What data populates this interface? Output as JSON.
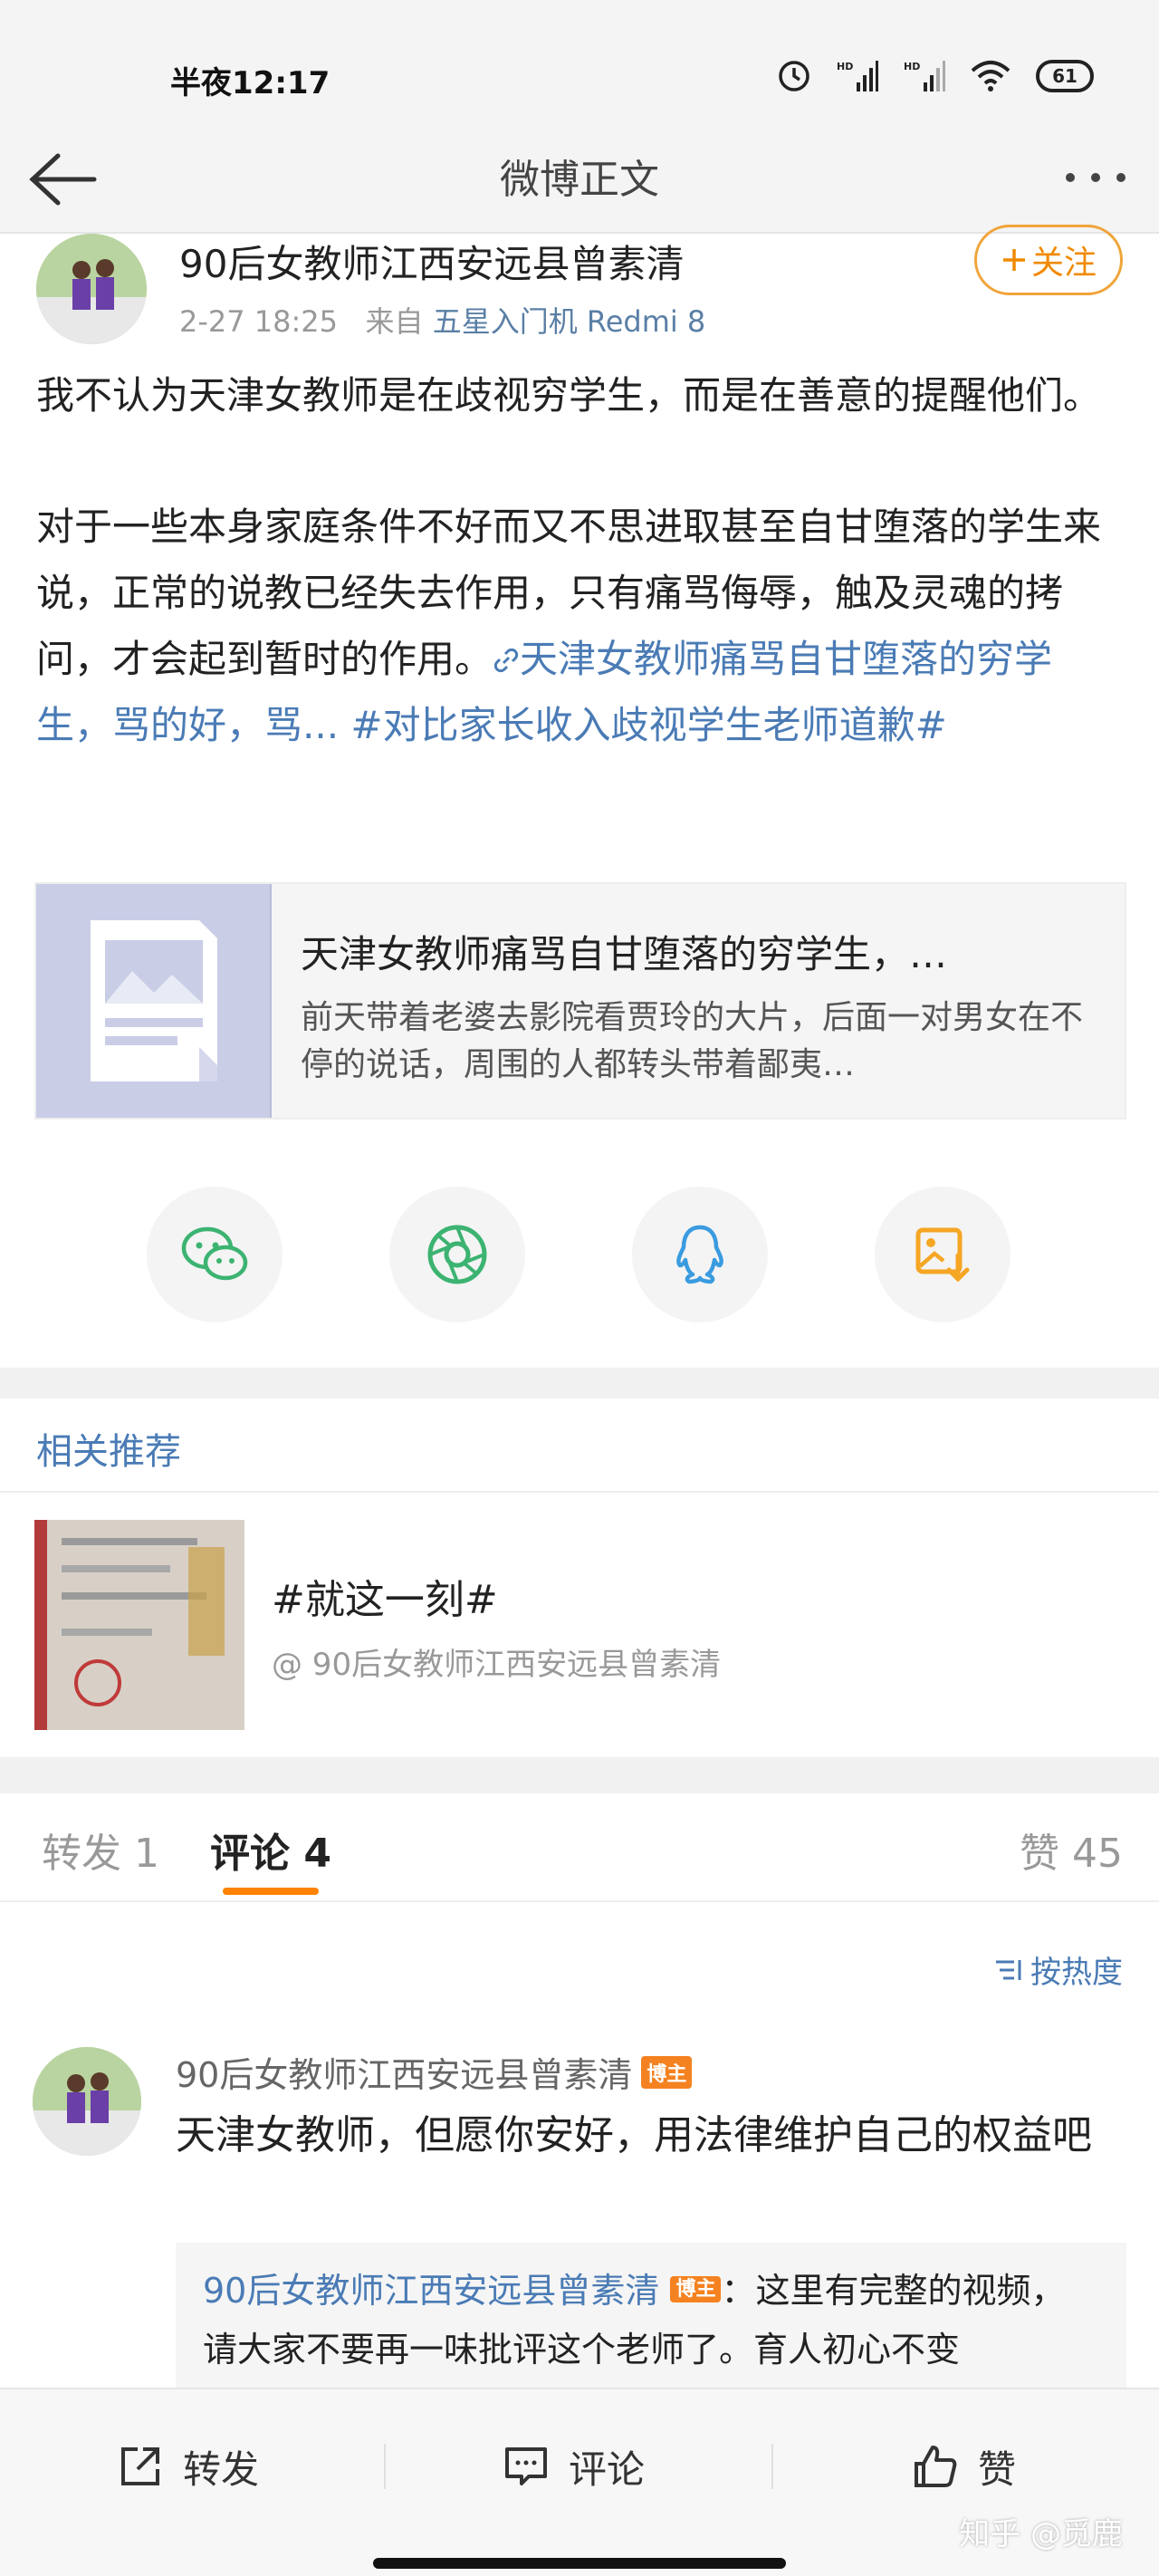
{
  "status_bar": {
    "time": "半夜12:17",
    "battery": "61",
    "icons": [
      "alarm-icon",
      "signal-hd-icon",
      "signal-hd-icon",
      "wifi-icon",
      "battery-icon"
    ]
  },
  "nav": {
    "title": "微博正文",
    "back_icon": "arrow-left-icon",
    "more_icon": "more-dots-icon"
  },
  "author": {
    "name": "90后女教师江西安远县曾素清",
    "time": "2-27 18:25",
    "from_label": "来自",
    "source": "五星入门机 Redmi 8",
    "follow_label": "关注"
  },
  "post": {
    "paragraph1": "我不认为天津女教师是在歧视穷学生，而是在善意的提醒他们。",
    "paragraph2_text": "对于一些本身家庭条件不好而又不思进取甚至自甘堕落的学生来说，正常的说教已经失去作用，只有痛骂侮辱，触及灵魂的拷问，才会起到暂时的作用。",
    "paragraph2_link": "天津女教师痛骂自甘堕落的穷学生，骂的好，骂...",
    "paragraph2_hashtag": " #对比家长收入歧视学生老师道歉#"
  },
  "link_card": {
    "title": "天津女教师痛骂自甘堕落的穷学生，…",
    "description": "前天带着老婆去影院看贾玲的大片，后面一对男女在不停的说话，周围的人都转头带着鄙夷…"
  },
  "share": [
    "wechat-icon",
    "moments-icon",
    "qq-icon",
    "save-image-icon"
  ],
  "related": {
    "header": "相关推荐",
    "title": "#就这一刻#",
    "author": "@ 90后女教师江西安远县曾素清"
  },
  "tabs": {
    "repost": "转发 1",
    "comment": "评论 4",
    "like": "赞 45"
  },
  "sort_label": "按热度",
  "comment": {
    "name": "90后女教师江西安远县曾素清",
    "badge": "博主",
    "text": "天津女教师，但愿你安好，用法律维护自己的权益吧",
    "reply_name": "90后女教师江西安远县曾素清",
    "reply_badge": "博主",
    "reply_text": "：这里有完整的视频，请大家不要再一味批评这个老师了。育人初心不变"
  },
  "bottom_bar": {
    "repost": "转发",
    "comment": "评论",
    "like": "赞"
  },
  "watermark": "知乎 @觅鹿",
  "colors": {
    "accent_orange": "#ff8200",
    "link_blue": "#4a7bb5",
    "wechat_green": "#3cb371",
    "qq_blue": "#3a9be0",
    "save_orange": "#f5a623"
  }
}
